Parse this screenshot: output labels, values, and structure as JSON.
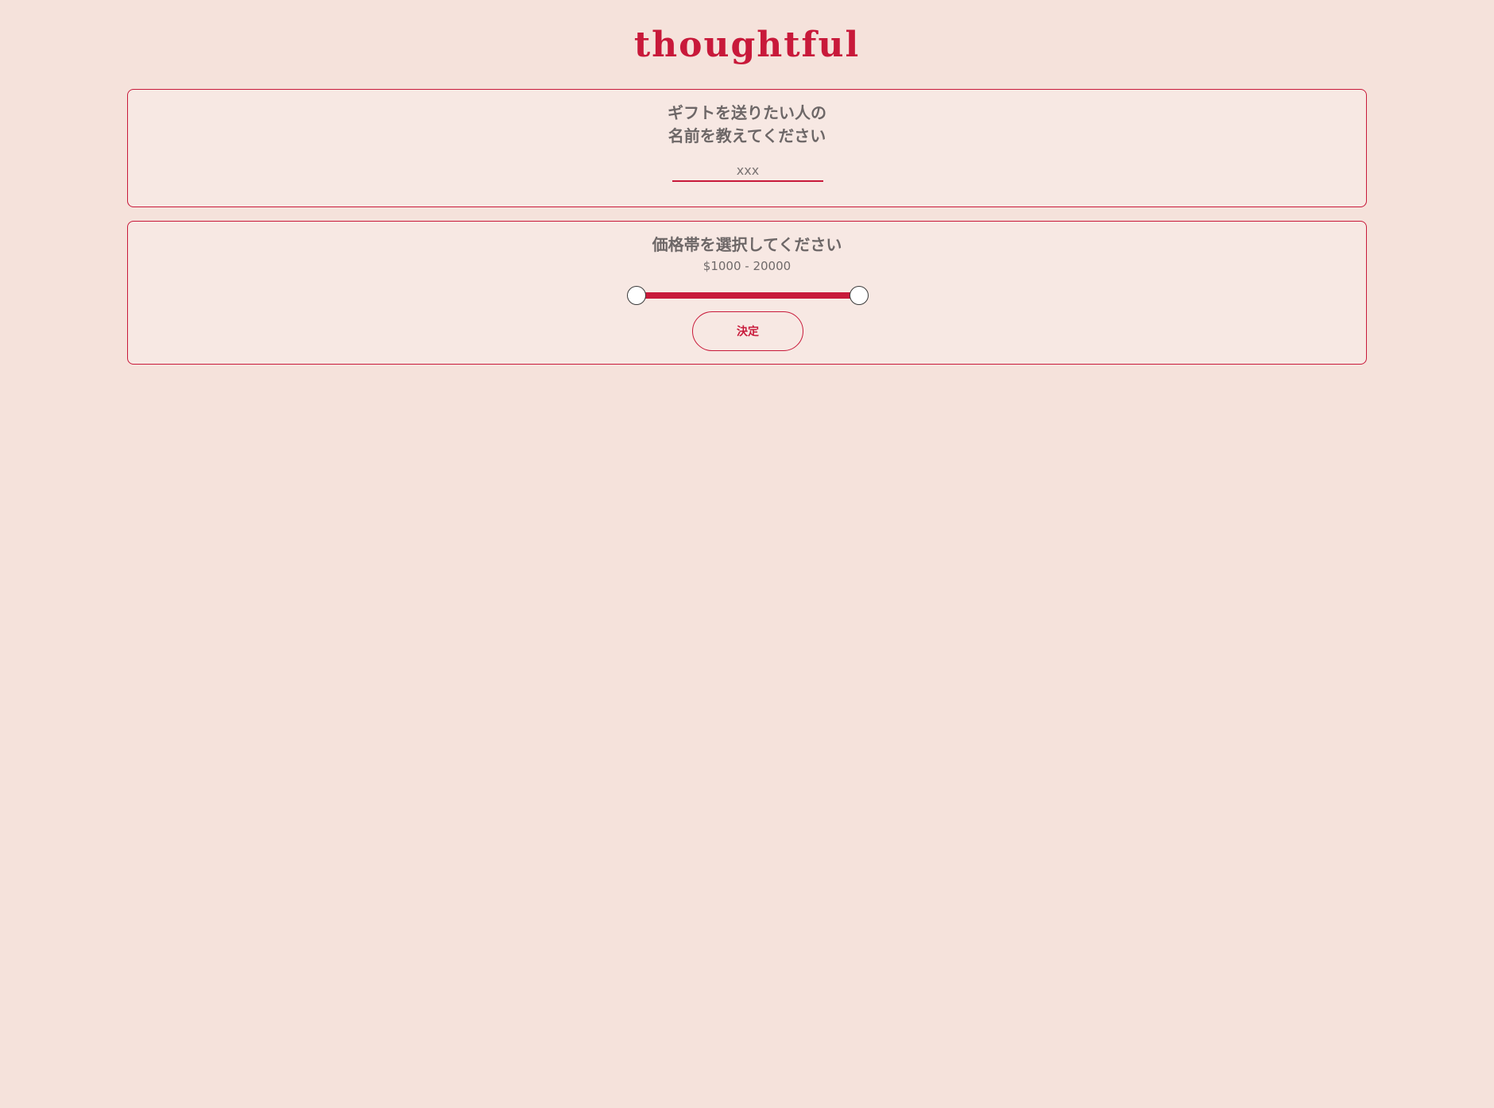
{
  "header": {
    "logo_text": "thoughtful"
  },
  "name_card": {
    "prompt_line1": "ギフトを送りたい人の",
    "prompt_line2": "名前を教えてください",
    "input_placeholder": "xxx",
    "input_value": ""
  },
  "price_card": {
    "prompt": "価格帯を選択してください",
    "range_label": "$1000 - 20000",
    "slider": {
      "min_fraction": 0.0,
      "max_fraction": 1.0
    },
    "submit_label": "決定"
  },
  "colors": {
    "accent": "#c8193a",
    "background": "#f5e2db",
    "card_background": "#f7e8e3",
    "text": "#6b6b6b"
  }
}
